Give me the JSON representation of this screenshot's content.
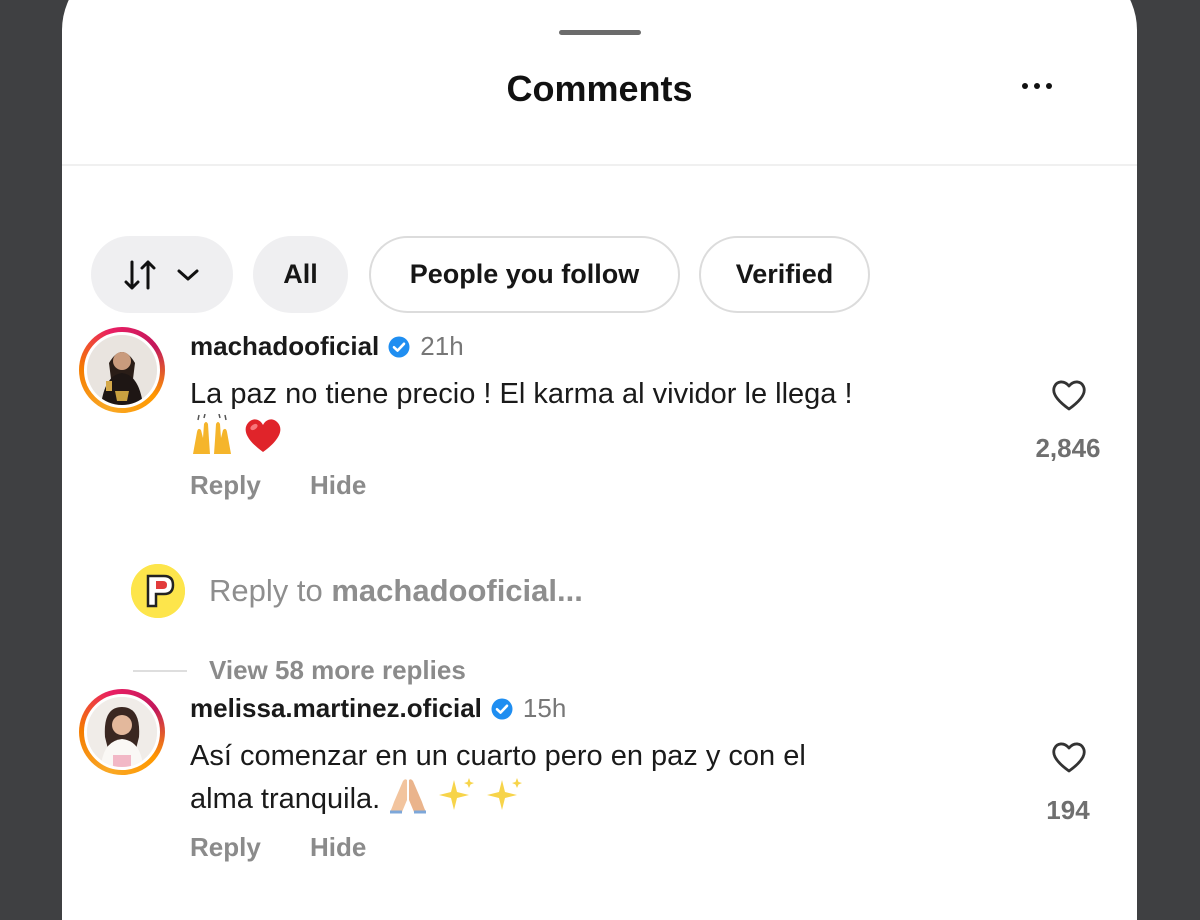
{
  "header": {
    "title": "Comments"
  },
  "filters": {
    "sort_icon": "sort-arrows-icon",
    "chips": [
      "All",
      "People you follow",
      "Verified"
    ]
  },
  "comments": [
    {
      "username": "machadooficial",
      "time": "21h",
      "text": "La paz no tiene precio ! El karma al vividor le llega !",
      "emojis": [
        "raising-hands-emoji",
        "red-heart-emoji"
      ],
      "likes": "2,846",
      "reply_label": "Reply",
      "hide_label": "Hide"
    },
    {
      "username": "melissa.martinez.oficial",
      "time": "15h",
      "text_line1": "Así comenzar en un cuarto pero en paz y con el",
      "text_line2": "alma tranquila.",
      "emojis": [
        "folded-hands-emoji",
        "sparkles-emoji",
        "sparkles-emoji"
      ],
      "likes": "194",
      "reply_label": "Reply",
      "hide_label": "Hide"
    }
  ],
  "reply_box": {
    "prefix": "Reply to ",
    "target": "machadooficial..."
  },
  "view_more": "View 58 more replies",
  "colors": {
    "verified": "#1f8ef1",
    "sheet": "#ffffff",
    "backdrop": "#3f4042"
  }
}
